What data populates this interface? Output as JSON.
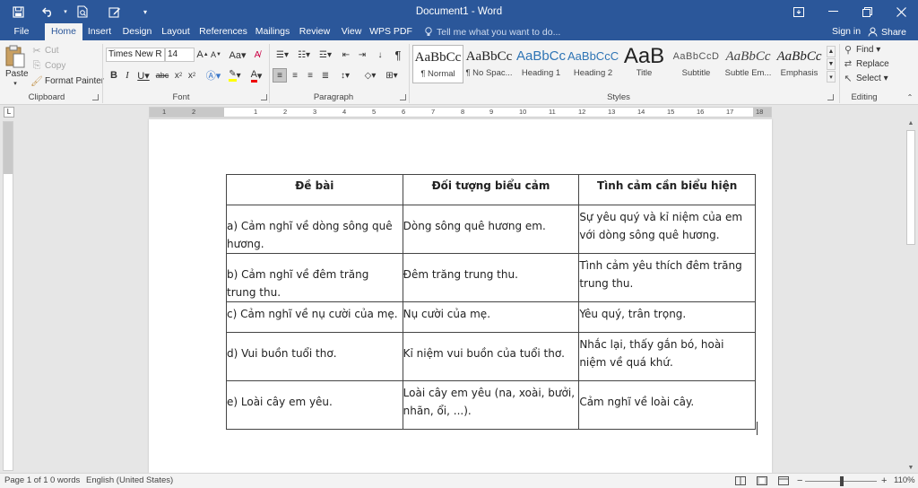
{
  "window": {
    "title": "Document1 - Word",
    "accent": "#2b579a"
  },
  "tabs": [
    {
      "label": "File",
      "active": false
    },
    {
      "label": "Home",
      "active": true
    },
    {
      "label": "Insert",
      "active": false
    },
    {
      "label": "Design",
      "active": false
    },
    {
      "label": "Layout",
      "active": false
    },
    {
      "label": "References",
      "active": false
    },
    {
      "label": "Mailings",
      "active": false
    },
    {
      "label": "Review",
      "active": false
    },
    {
      "label": "View",
      "active": false
    },
    {
      "label": "WPS PDF",
      "active": false
    }
  ],
  "tell_me": {
    "placeholder": "Tell me what you want to do...",
    "icon": "lightbulb-icon"
  },
  "account": {
    "sign_in": "Sign in",
    "share": "Share"
  },
  "ribbon": {
    "clipboard": {
      "label": "Clipboard",
      "paste": "Paste",
      "cut": "Cut",
      "copy": "Copy",
      "format_painter": "Format Painter"
    },
    "font": {
      "label": "Font",
      "font_name": "Times New R",
      "font_size": "14"
    },
    "paragraph": {
      "label": "Paragraph"
    },
    "styles": {
      "label": "Styles",
      "items": [
        {
          "sample": "AaBbCc",
          "name": "¶ Normal",
          "selected": true
        },
        {
          "sample": "AaBbCc",
          "name": "¶ No Spac...",
          "selected": false
        },
        {
          "sample": "AaBbCc",
          "name": "Heading 1",
          "selected": false
        },
        {
          "sample": "AaBbCcC",
          "name": "Heading 2",
          "selected": false
        },
        {
          "sample": "AaB",
          "name": "Title",
          "selected": false
        },
        {
          "sample": "AaBbCcD",
          "name": "Subtitle",
          "selected": false
        },
        {
          "sample": "AaBbCc",
          "name": "Subtle Em...",
          "selected": false
        },
        {
          "sample": "AaBbCc",
          "name": "Emphasis",
          "selected": false
        }
      ]
    },
    "editing": {
      "label": "Editing",
      "find": "Find",
      "replace": "Replace",
      "select": "Select"
    }
  },
  "ruler": {
    "numbers": [
      "1",
      "2",
      "1",
      "2",
      "3",
      "4",
      "5",
      "6",
      "7",
      "8",
      "9",
      "10",
      "11",
      "12",
      "13",
      "14",
      "15",
      "16",
      "17",
      "18"
    ]
  },
  "table": {
    "headers": [
      "Đề bài",
      "Đối tượng biểu cảm",
      "Tình cảm cần biểu hiện"
    ],
    "rows": [
      [
        "a) Cảm nghĩ về dòng sông quê hương.",
        "Dòng sông quê hương em.",
        "Sự yêu quý và kỉ niệm của em với dòng sông quê hương."
      ],
      [
        "b) Cảm nghĩ về đêm trăng trung thu.",
        "Đêm trăng trung thu.",
        "Tình cảm yêu thích đêm trăng trung thu."
      ],
      [
        "c) Cảm nghĩ về nụ cười của mẹ.",
        "Nụ cười của mẹ.",
        "Yêu quý, trân trọng."
      ],
      [
        "d) Vui buồn tuổi thơ.",
        "Kỉ niệm vui buồn của tuổi thơ.",
        "Nhắc lại, thấy gắn bó, hoài niệm về quá khứ."
      ],
      [
        "e) Loài cây em yêu.",
        "Loài cây em yêu (na, xoài, bưởi, nhãn, ổi, ...).",
        "Cảm nghĩ về loài cây."
      ]
    ]
  },
  "status": {
    "page": "Page 1 of 1",
    "words": "0 words",
    "language": "English (United States)",
    "zoom": "110%",
    "zoom_value": 110
  }
}
